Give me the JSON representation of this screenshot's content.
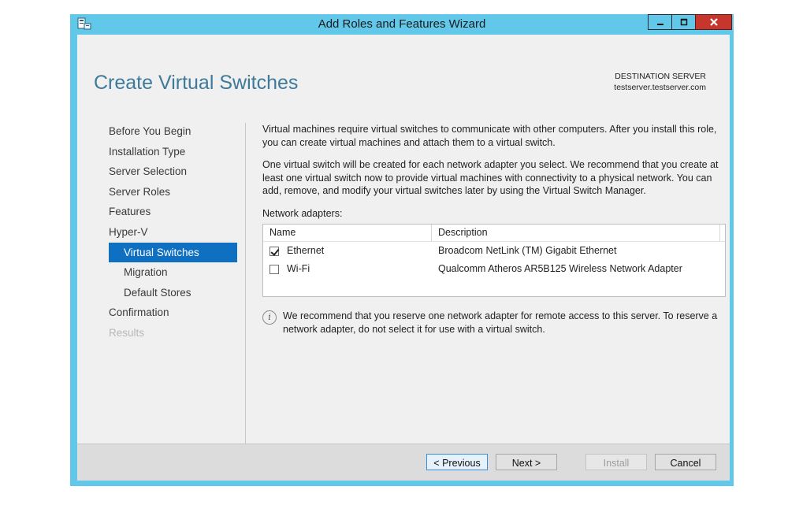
{
  "window": {
    "title": "Add Roles and Features Wizard",
    "controls": {
      "minimize_icon": "minimize-icon",
      "maximize_icon": "maximize-icon",
      "close_icon": "close-icon"
    }
  },
  "header": {
    "page_title": "Create Virtual Switches",
    "destination_label": "DESTINATION SERVER",
    "destination_server": "testserver.testserver.com"
  },
  "nav": {
    "items": [
      {
        "label": "Before You Begin",
        "state": "normal"
      },
      {
        "label": "Installation Type",
        "state": "normal"
      },
      {
        "label": "Server Selection",
        "state": "normal"
      },
      {
        "label": "Server Roles",
        "state": "normal"
      },
      {
        "label": "Features",
        "state": "normal"
      },
      {
        "label": "Hyper-V",
        "state": "normal"
      },
      {
        "label": "Virtual Switches",
        "state": "active"
      },
      {
        "label": "Migration",
        "state": "normal"
      },
      {
        "label": "Default Stores",
        "state": "normal"
      },
      {
        "label": "Confirmation",
        "state": "normal"
      },
      {
        "label": "Results",
        "state": "disabled"
      }
    ]
  },
  "content": {
    "para1": "Virtual machines require virtual switches to communicate with other computers. After you install this role, you can create virtual machines and attach them to a virtual switch.",
    "para2": "One virtual switch will be created for each network adapter you select. We recommend that you create at least one virtual switch now to provide virtual machines with connectivity to a physical network. You can add, remove, and modify your virtual switches later by using the Virtual Switch Manager.",
    "adapters_label": "Network adapters:",
    "table": {
      "col_name": "Name",
      "col_description": "Description",
      "rows": [
        {
          "name": "Ethernet",
          "description": "Broadcom NetLink (TM) Gigabit Ethernet",
          "checked": true
        },
        {
          "name": "Wi-Fi",
          "description": "Qualcomm Atheros AR5B125 Wireless Network Adapter",
          "checked": false
        }
      ]
    },
    "info_text": "We recommend that you reserve one network adapter for remote access to this server. To reserve a network adapter, do not select it for use with a virtual switch."
  },
  "footer": {
    "previous": "< Previous",
    "next": "Next >",
    "install": "Install",
    "cancel": "Cancel"
  },
  "colors": {
    "window_frame": "#61c8ea",
    "accent": "#0f6fc0",
    "page_title": "#3e7a9a",
    "close_button": "#c7362d"
  }
}
